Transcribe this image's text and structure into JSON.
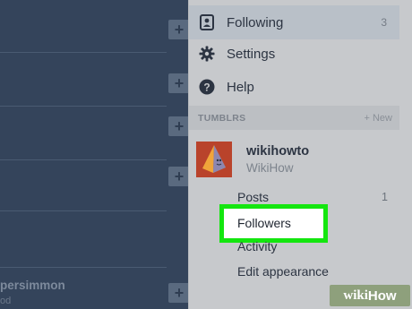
{
  "background": {
    "list_item_name": "persimmon",
    "list_item_sub": "od",
    "add_button_label": "+"
  },
  "menu": {
    "items": [
      {
        "label": "Following",
        "count": "3",
        "icon": "following-icon"
      },
      {
        "label": "Settings",
        "icon": "gear-icon"
      },
      {
        "label": "Help",
        "icon": "help-icon"
      }
    ],
    "tumblrs_header": "TUMBLRS",
    "new_label": "+ New",
    "blog": {
      "name": "wikihowto",
      "title": "WikiHow",
      "avatar_icon": "pyramid-avatar-icon"
    },
    "blog_links": [
      {
        "label": "Posts",
        "count": "1"
      },
      {
        "label": "Followers"
      },
      {
        "label": "Activity"
      },
      {
        "label": "Edit appearance"
      }
    ]
  },
  "watermark": {
    "part1": "wiki",
    "part2": "How"
  },
  "colors": {
    "highlight_border": "#14e60f",
    "menu_bg": "#c7c9cc",
    "dashboard_bg": "#2f3d52"
  }
}
